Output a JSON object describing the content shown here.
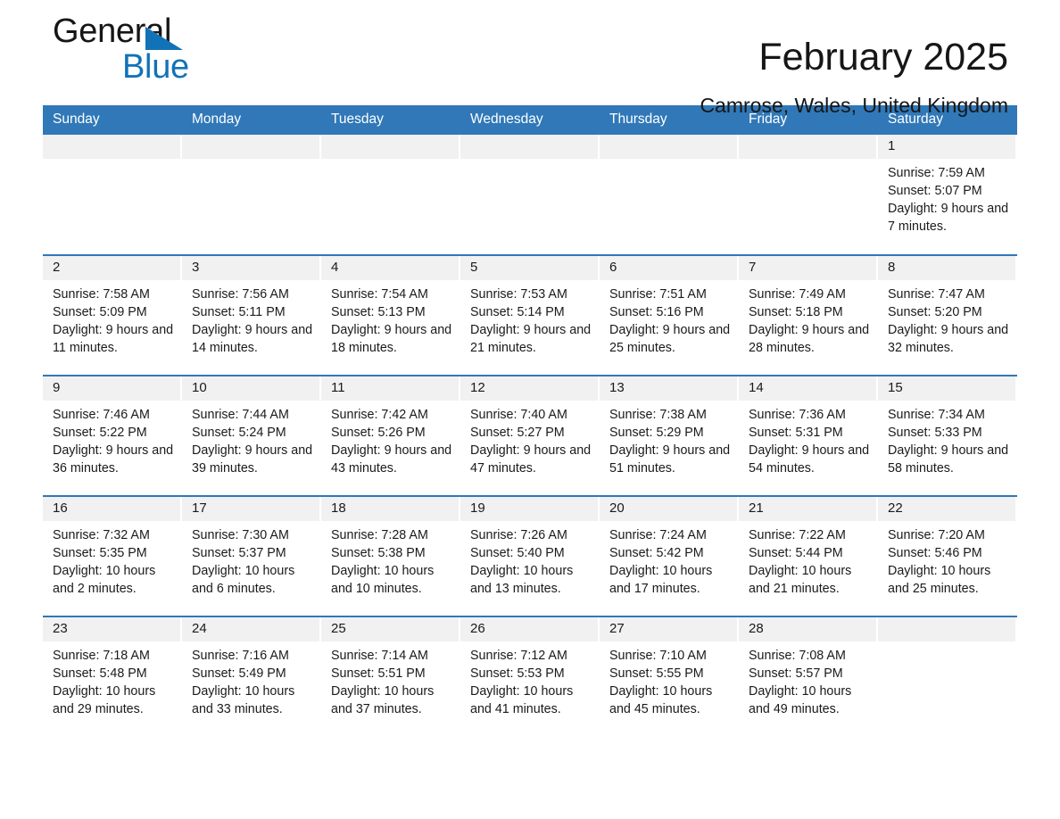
{
  "brand": {
    "name_part1": "General",
    "name_part2": "Blue",
    "accent_color": "#1272b8"
  },
  "header": {
    "title": "February 2025",
    "subtitle": "Camrose, Wales, United Kingdom",
    "header_bg_color": "#3078b8",
    "daynum_bg_color": "#f1f1f1"
  },
  "weekdays": [
    {
      "label": "Sunday"
    },
    {
      "label": "Monday"
    },
    {
      "label": "Tuesday"
    },
    {
      "label": "Wednesday"
    },
    {
      "label": "Thursday"
    },
    {
      "label": "Friday"
    },
    {
      "label": "Saturday"
    }
  ],
  "weeks": [
    [
      {
        "day": "",
        "empty": true
      },
      {
        "day": "",
        "empty": true
      },
      {
        "day": "",
        "empty": true
      },
      {
        "day": "",
        "empty": true
      },
      {
        "day": "",
        "empty": true
      },
      {
        "day": "",
        "empty": true
      },
      {
        "day": "1",
        "sunrise": "Sunrise: 7:59 AM",
        "sunset": "Sunset: 5:07 PM",
        "daylight": "Daylight: 9 hours and 7 minutes."
      }
    ],
    [
      {
        "day": "2",
        "sunrise": "Sunrise: 7:58 AM",
        "sunset": "Sunset: 5:09 PM",
        "daylight": "Daylight: 9 hours and 11 minutes."
      },
      {
        "day": "3",
        "sunrise": "Sunrise: 7:56 AM",
        "sunset": "Sunset: 5:11 PM",
        "daylight": "Daylight: 9 hours and 14 minutes."
      },
      {
        "day": "4",
        "sunrise": "Sunrise: 7:54 AM",
        "sunset": "Sunset: 5:13 PM",
        "daylight": "Daylight: 9 hours and 18 minutes."
      },
      {
        "day": "5",
        "sunrise": "Sunrise: 7:53 AM",
        "sunset": "Sunset: 5:14 PM",
        "daylight": "Daylight: 9 hours and 21 minutes."
      },
      {
        "day": "6",
        "sunrise": "Sunrise: 7:51 AM",
        "sunset": "Sunset: 5:16 PM",
        "daylight": "Daylight: 9 hours and 25 minutes."
      },
      {
        "day": "7",
        "sunrise": "Sunrise: 7:49 AM",
        "sunset": "Sunset: 5:18 PM",
        "daylight": "Daylight: 9 hours and 28 minutes."
      },
      {
        "day": "8",
        "sunrise": "Sunrise: 7:47 AM",
        "sunset": "Sunset: 5:20 PM",
        "daylight": "Daylight: 9 hours and 32 minutes."
      }
    ],
    [
      {
        "day": "9",
        "sunrise": "Sunrise: 7:46 AM",
        "sunset": "Sunset: 5:22 PM",
        "daylight": "Daylight: 9 hours and 36 minutes."
      },
      {
        "day": "10",
        "sunrise": "Sunrise: 7:44 AM",
        "sunset": "Sunset: 5:24 PM",
        "daylight": "Daylight: 9 hours and 39 minutes."
      },
      {
        "day": "11",
        "sunrise": "Sunrise: 7:42 AM",
        "sunset": "Sunset: 5:26 PM",
        "daylight": "Daylight: 9 hours and 43 minutes."
      },
      {
        "day": "12",
        "sunrise": "Sunrise: 7:40 AM",
        "sunset": "Sunset: 5:27 PM",
        "daylight": "Daylight: 9 hours and 47 minutes."
      },
      {
        "day": "13",
        "sunrise": "Sunrise: 7:38 AM",
        "sunset": "Sunset: 5:29 PM",
        "daylight": "Daylight: 9 hours and 51 minutes."
      },
      {
        "day": "14",
        "sunrise": "Sunrise: 7:36 AM",
        "sunset": "Sunset: 5:31 PM",
        "daylight": "Daylight: 9 hours and 54 minutes."
      },
      {
        "day": "15",
        "sunrise": "Sunrise: 7:34 AM",
        "sunset": "Sunset: 5:33 PM",
        "daylight": "Daylight: 9 hours and 58 minutes."
      }
    ],
    [
      {
        "day": "16",
        "sunrise": "Sunrise: 7:32 AM",
        "sunset": "Sunset: 5:35 PM",
        "daylight": "Daylight: 10 hours and 2 minutes."
      },
      {
        "day": "17",
        "sunrise": "Sunrise: 7:30 AM",
        "sunset": "Sunset: 5:37 PM",
        "daylight": "Daylight: 10 hours and 6 minutes."
      },
      {
        "day": "18",
        "sunrise": "Sunrise: 7:28 AM",
        "sunset": "Sunset: 5:38 PM",
        "daylight": "Daylight: 10 hours and 10 minutes."
      },
      {
        "day": "19",
        "sunrise": "Sunrise: 7:26 AM",
        "sunset": "Sunset: 5:40 PM",
        "daylight": "Daylight: 10 hours and 13 minutes."
      },
      {
        "day": "20",
        "sunrise": "Sunrise: 7:24 AM",
        "sunset": "Sunset: 5:42 PM",
        "daylight": "Daylight: 10 hours and 17 minutes."
      },
      {
        "day": "21",
        "sunrise": "Sunrise: 7:22 AM",
        "sunset": "Sunset: 5:44 PM",
        "daylight": "Daylight: 10 hours and 21 minutes."
      },
      {
        "day": "22",
        "sunrise": "Sunrise: 7:20 AM",
        "sunset": "Sunset: 5:46 PM",
        "daylight": "Daylight: 10 hours and 25 minutes."
      }
    ],
    [
      {
        "day": "23",
        "sunrise": "Sunrise: 7:18 AM",
        "sunset": "Sunset: 5:48 PM",
        "daylight": "Daylight: 10 hours and 29 minutes."
      },
      {
        "day": "24",
        "sunrise": "Sunrise: 7:16 AM",
        "sunset": "Sunset: 5:49 PM",
        "daylight": "Daylight: 10 hours and 33 minutes."
      },
      {
        "day": "25",
        "sunrise": "Sunrise: 7:14 AM",
        "sunset": "Sunset: 5:51 PM",
        "daylight": "Daylight: 10 hours and 37 minutes."
      },
      {
        "day": "26",
        "sunrise": "Sunrise: 7:12 AM",
        "sunset": "Sunset: 5:53 PM",
        "daylight": "Daylight: 10 hours and 41 minutes."
      },
      {
        "day": "27",
        "sunrise": "Sunrise: 7:10 AM",
        "sunset": "Sunset: 5:55 PM",
        "daylight": "Daylight: 10 hours and 45 minutes."
      },
      {
        "day": "28",
        "sunrise": "Sunrise: 7:08 AM",
        "sunset": "Sunset: 5:57 PM",
        "daylight": "Daylight: 10 hours and 49 minutes."
      },
      {
        "day": "",
        "empty": true
      }
    ]
  ]
}
